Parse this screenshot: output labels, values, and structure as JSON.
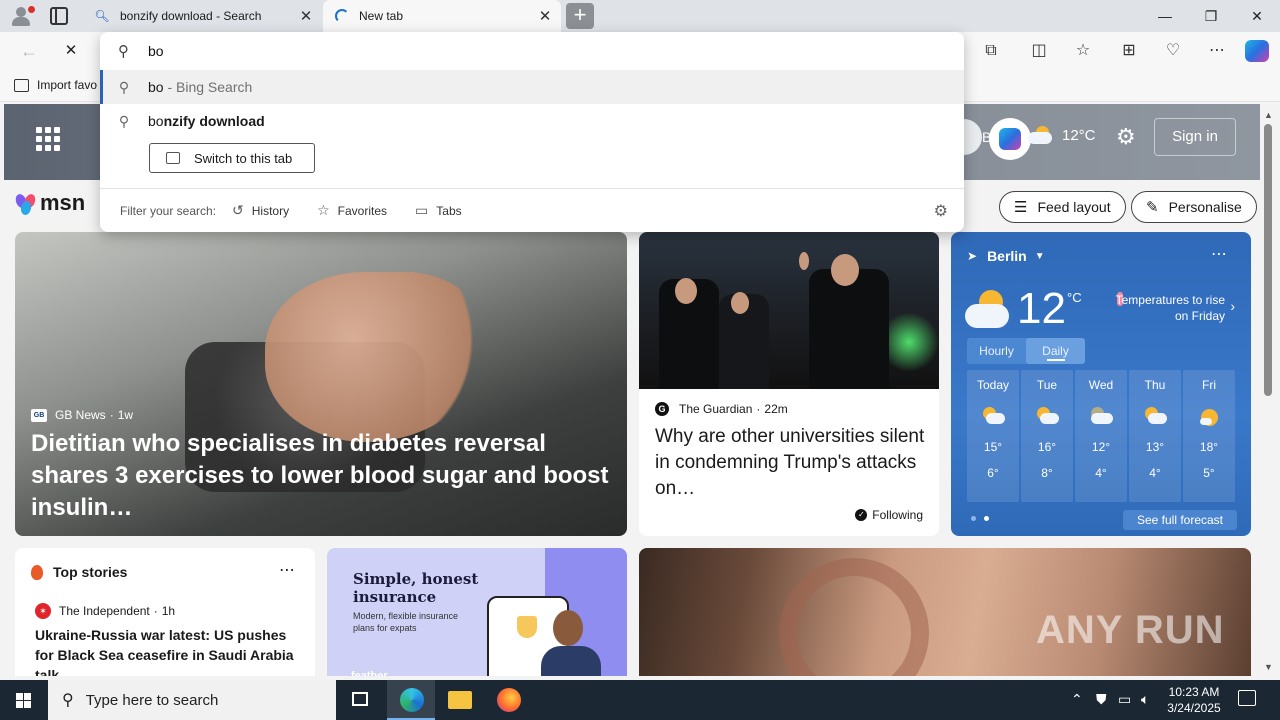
{
  "browser": {
    "tabs": [
      {
        "title": "bonzify download - Search",
        "close": "✕"
      },
      {
        "title": "New tab",
        "close": "✕"
      }
    ],
    "new_tab": "+",
    "window": {
      "minimize": "—",
      "restore": "❐",
      "close": "✕"
    }
  },
  "toolbar": {
    "back": "←",
    "stop": "✕"
  },
  "favorites_bar": {
    "import_label": "Import favo"
  },
  "omnibox": {
    "value": "bo",
    "suggestions": [
      {
        "match": "bo",
        "suffix": " - Bing Search"
      },
      {
        "prefix": "bo",
        "rest": "nzify download"
      }
    ],
    "switch_tab_label": "Switch to this tab",
    "filter_label": "Filter your search:",
    "filters": [
      "History",
      "Favorites",
      "Tabs"
    ]
  },
  "msn": {
    "location_short": "Berlin",
    "temperature": "12°C",
    "sign_in": "Sign in",
    "logo_text": "msn",
    "feed_layout": "Feed layout",
    "personalise": "Personalise"
  },
  "hero": {
    "source": "GB News",
    "age": "1w",
    "headline": "Dietitian who specialises in diabetes reversal shares 3 exercises to lower blood sugar and boost insulin…"
  },
  "news2": {
    "source": "The Guardian",
    "age": "22m",
    "headline": "Why are other universities silent in condemning Trump's attacks on…",
    "following": "Following"
  },
  "weather": {
    "city": "Berlin",
    "temp": "12",
    "unit": "°C",
    "note": "Temperatures to rise on Friday",
    "tabs": [
      "Hourly",
      "Daily"
    ],
    "selected_tab": "Daily",
    "days": [
      {
        "name": "Today",
        "hi": "15°",
        "lo": "6°"
      },
      {
        "name": "Tue",
        "hi": "16°",
        "lo": "8°"
      },
      {
        "name": "Wed",
        "hi": "12°",
        "lo": "4°"
      },
      {
        "name": "Thu",
        "hi": "13°",
        "lo": "4°"
      },
      {
        "name": "Fri",
        "hi": "18°",
        "lo": "5°"
      }
    ],
    "see_full": "See full forecast"
  },
  "top_stories": {
    "title": "Top stories",
    "source": "The Independent",
    "age": "1h",
    "headline": "Ukraine-Russia war latest: US pushes for Black Sea ceasefire in Saudi Arabia talk…"
  },
  "ad": {
    "title": "Simple, honest insurance",
    "subtitle": "Modern, flexible insurance plans for expats",
    "brand": "feather"
  },
  "watermark": "ANY RUN",
  "taskbar": {
    "search_placeholder": "Type here to search",
    "time": "10:23 AM",
    "date": "3/24/2025"
  },
  "colors": {
    "accent": "#2c62b4",
    "weather_bg": "#3a78c9",
    "taskbar": "#1b2733"
  }
}
